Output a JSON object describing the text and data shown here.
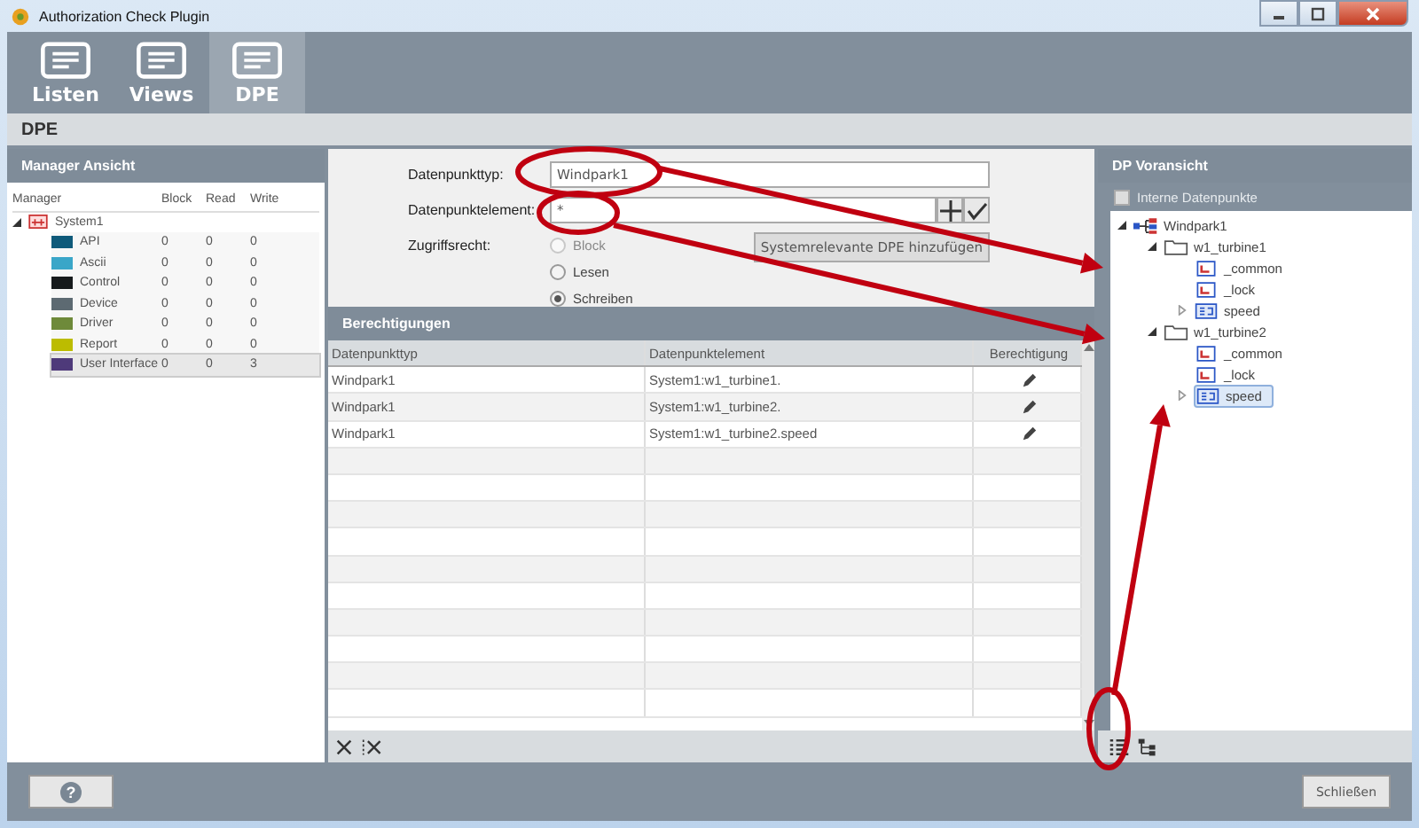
{
  "window": {
    "title": "Authorization Check Plugin"
  },
  "tabs": [
    {
      "label": "Listen",
      "selected": false
    },
    {
      "label": "Views",
      "selected": false
    },
    {
      "label": "DPE",
      "selected": true
    }
  ],
  "page_title": "DPE",
  "manager_panel": {
    "title": "Manager Ansicht",
    "columns": [
      "Manager",
      "Block",
      "Read",
      "Write"
    ],
    "root": {
      "label": "System1",
      "expanded": true,
      "children": [
        {
          "name": "API",
          "color": "#0f5a7a",
          "block": "0",
          "read": "0",
          "write": "0",
          "selected": false
        },
        {
          "name": "Ascii",
          "color": "#3aa6c8",
          "block": "0",
          "read": "0",
          "write": "0",
          "selected": false
        },
        {
          "name": "Control",
          "color": "#161a1c",
          "block": "0",
          "read": "0",
          "write": "0",
          "selected": false
        },
        {
          "name": "Device",
          "color": "#5d6a72",
          "block": "0",
          "read": "0",
          "write": "0",
          "selected": false
        },
        {
          "name": "Driver",
          "color": "#6e8a3a",
          "block": "0",
          "read": "0",
          "write": "0",
          "selected": false
        },
        {
          "name": "Report",
          "color": "#bcbc00",
          "block": "0",
          "read": "0",
          "write": "0",
          "selected": false
        },
        {
          "name": "User Interface",
          "color": "#4e3a7a",
          "block": "0",
          "read": "0",
          "write": "3",
          "selected": true
        }
      ]
    }
  },
  "form": {
    "type_label": "Datenpunkttyp:",
    "type_value": "Windpark1",
    "element_label": "Datenpunktelement:",
    "element_value": "*",
    "access_label": "Zugriffsrecht:",
    "access_options": [
      {
        "label": "Block",
        "selected": false,
        "disabled": true
      },
      {
        "label": "Lesen",
        "selected": false,
        "disabled": false
      },
      {
        "label": "Schreiben",
        "selected": true,
        "disabled": false
      }
    ],
    "add_system_button": "Systemrelevante DPE hinzufügen"
  },
  "permissions": {
    "title": "Berechtigungen",
    "columns": [
      "Datenpunkttyp",
      "Datenpunktelement",
      "Berechtigung"
    ],
    "rows": [
      {
        "type": "Windpark1",
        "element": "System1:w1_turbine1."
      },
      {
        "type": "Windpark1",
        "element": "System1:w1_turbine2."
      },
      {
        "type": "Windpark1",
        "element": "System1:w1_turbine2.speed"
      }
    ]
  },
  "preview": {
    "title": "DP Voransicht",
    "internal_checkbox": {
      "label": "Interne Datenpunkte",
      "checked": false
    },
    "tree": [
      {
        "label": "Windpark1",
        "kind": "struct",
        "expanded": true,
        "selected": false,
        "children": [
          {
            "label": "w1_turbine1",
            "kind": "folder",
            "expanded": true,
            "selected": false,
            "children": [
              {
                "label": "_common",
                "kind": "config",
                "selected": false
              },
              {
                "label": "_lock",
                "kind": "config",
                "selected": false
              },
              {
                "label": "speed",
                "kind": "float",
                "expanded": false,
                "selected": false
              }
            ]
          },
          {
            "label": "w1_turbine2",
            "kind": "folder",
            "expanded": true,
            "selected": false,
            "children": [
              {
                "label": "_common",
                "kind": "config",
                "selected": false
              },
              {
                "label": "_lock",
                "kind": "config",
                "selected": false
              },
              {
                "label": "speed",
                "kind": "float",
                "expanded": false,
                "selected": true
              }
            ]
          }
        ]
      }
    ]
  },
  "help_button": "?",
  "close_button": "Schließen"
}
